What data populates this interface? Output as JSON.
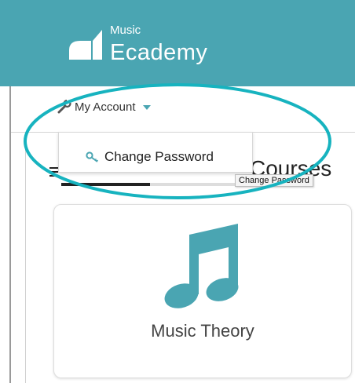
{
  "header": {
    "logo_small": "Music",
    "logo_big": "Ecademy",
    "logo_icon": "music-ecademy-logo-icon"
  },
  "account_menu": {
    "label": "My Account",
    "icon": "wrench-icon",
    "caret_icon": "caret-down-icon"
  },
  "dropdown": {
    "items": [
      {
        "label": "Change Password",
        "icon": "key-icon"
      }
    ]
  },
  "tooltip": "Change Password",
  "courses": {
    "title": "Courses",
    "items": [
      {
        "title": "Music Theory",
        "icon": "music-note-icon"
      }
    ]
  },
  "colors": {
    "header": "#4aa5b2",
    "accent": "#4aa5b2",
    "highlight": "#17b3bf"
  }
}
